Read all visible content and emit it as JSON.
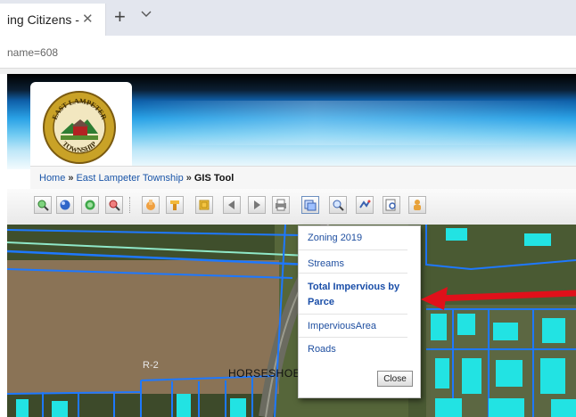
{
  "browser": {
    "tab_title": "ing Citizens -",
    "tab_close": "✕",
    "new_tab": "+",
    "address": "name=608"
  },
  "breadcrumb": {
    "home": "Home",
    "sep1": "»",
    "township": "East Lampeter Township",
    "sep2": "»",
    "current": "GIS Tool"
  },
  "logo": {
    "top_text": "EAST LAMPETER",
    "bottom_text": "TOWNSHIP"
  },
  "toolbar": {
    "icons": [
      "zoom-in-icon",
      "zoom-out-icon",
      "globe-icon",
      "zoom-minus-icon",
      "pan-hand-icon",
      "identify-icon",
      "select-icon",
      "back-icon",
      "forward-icon",
      "print-icon",
      "layers-icon",
      "measure-icon",
      "draw-icon",
      "find-icon",
      "user-icon"
    ]
  },
  "map": {
    "zone_label": "R-2",
    "street_label": "HORSESHOE"
  },
  "layers_popup": {
    "items": [
      "Zoning 2019",
      "Streams",
      "Total Impervious by Parce",
      "ImperviousArea",
      "Roads"
    ],
    "close_label": "Close"
  },
  "colors": {
    "parcel_line": "#1e78ff",
    "impervious": "#22e3e3",
    "arrow": "#e0101a"
  }
}
